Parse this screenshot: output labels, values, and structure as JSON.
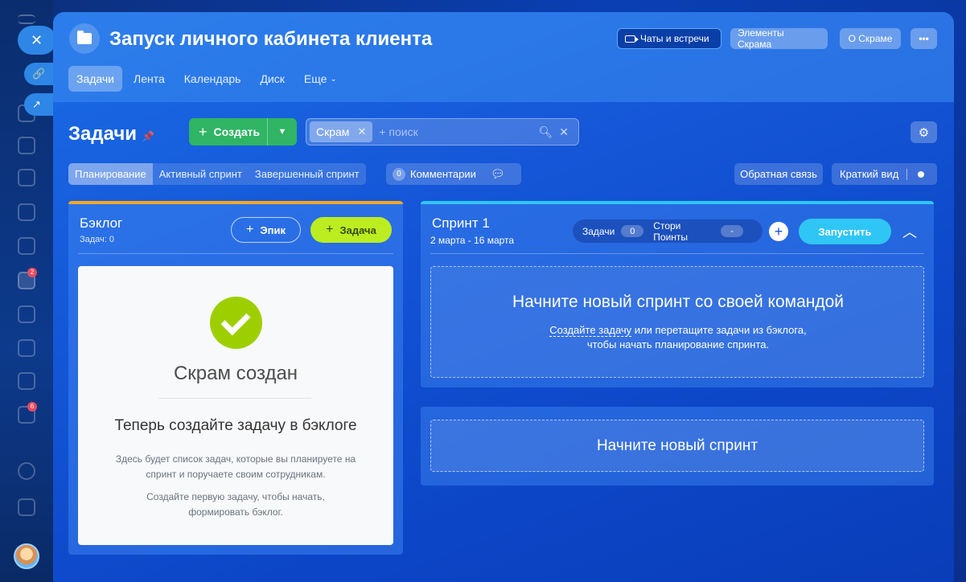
{
  "header": {
    "title": "Запуск личного кабинета клиента",
    "buttons": {
      "chats": "Чаты и встречи",
      "elements": "Элементы Скрама",
      "about": "О Скраме",
      "more": "•••"
    },
    "tabs": [
      "Задачи",
      "Лента",
      "Календарь",
      "Диск",
      "Еще"
    ]
  },
  "toolbar": {
    "title": "Задачи",
    "create_label": "Создать",
    "filter_chip": "Скрам",
    "search_placeholder": "+ поиск",
    "mode_tabs": [
      "Планирование",
      "Активный спринт",
      "Завершенный спринт"
    ],
    "comments_label": "Комментарии",
    "comments_count": "0",
    "feedback_label": "Обратная связь",
    "short_view_label": "Краткий вид"
  },
  "backlog": {
    "title": "Бэклог",
    "subtitle": "Задач: 0",
    "epic_label": "Эпик",
    "task_label": "Задача",
    "empty": {
      "title": "Скрам создан",
      "subtitle": "Теперь создайте задачу в бэклоге",
      "text1": "Здесь будет список задач, которые вы планируете на спринт и поручаете своим сотрудникам.",
      "text2": "Создайте первую задачу, чтобы начать, формировать бэклог."
    }
  },
  "sprint": {
    "title": "Спринт 1",
    "dates": "2 марта - 16 марта",
    "tasks_label": "Задачи",
    "tasks_count": "0",
    "points_label": "Стори Поинты",
    "points_value": "-",
    "start_label": "Запустить",
    "drop_title": "Начните новый спринт со своей командой",
    "drop_link": "Создайте задачу",
    "drop_text_rest": " или перетащите задачи из бэклога,",
    "drop_text_line2": "чтобы начать планирование спринта."
  },
  "new_sprint": {
    "label": "Начните новый спринт"
  },
  "sidebar": {
    "badges": [
      "2",
      "6"
    ]
  },
  "colors": {
    "accent_green": "#2fb563",
    "lime": "#bbed21",
    "sky": "#2fc6f6",
    "backlog_bar": "#f5a623"
  }
}
